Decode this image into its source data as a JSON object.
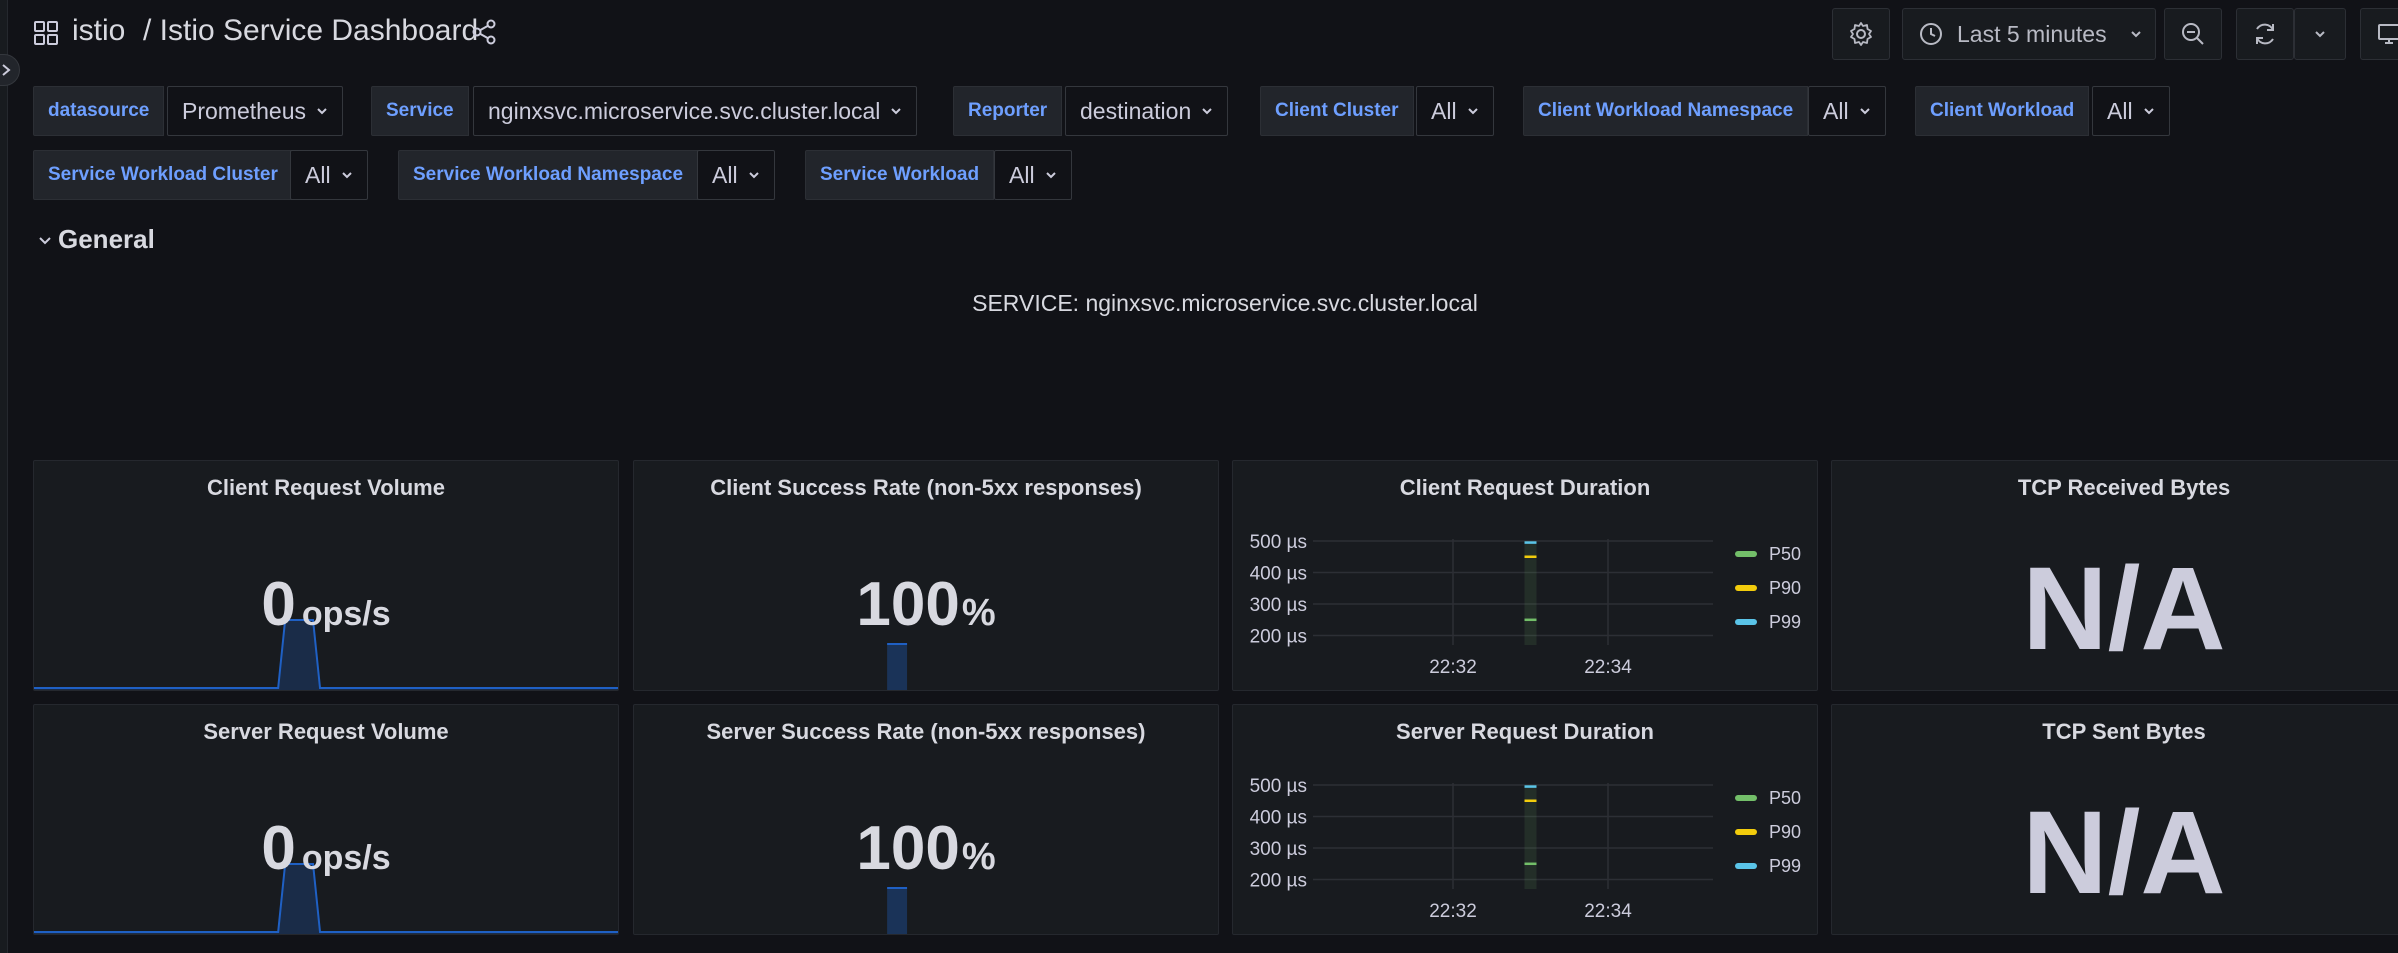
{
  "header": {
    "home": "istio",
    "title": "/ Istio Service Dashboard",
    "time_range": "Last 5 minutes"
  },
  "variables": {
    "datasource": {
      "label": "datasource",
      "value": "Prometheus"
    },
    "service": {
      "label": "Service",
      "value": "nginxsvc.microservice.svc.cluster.local"
    },
    "reporter": {
      "label": "Reporter",
      "value": "destination"
    },
    "client_cluster": {
      "label": "Client Cluster",
      "value": "All"
    },
    "client_workload_namespace": {
      "label": "Client Workload Namespace",
      "value": "All"
    },
    "client_workload": {
      "label": "Client Workload",
      "value": "All"
    },
    "service_workload_cluster": {
      "label": "Service Workload Cluster",
      "value": "All"
    },
    "service_workload_namespace": {
      "label": "Service Workload Namespace",
      "value": "All"
    },
    "service_workload": {
      "label": "Service Workload",
      "value": "All"
    }
  },
  "row": {
    "title": "General"
  },
  "service_banner": "SERVICE: nginxsvc.microservice.svc.cluster.local",
  "panels": {
    "client_request_volume": {
      "title": "Client Request Volume",
      "value": "0",
      "unit": "ops/s"
    },
    "client_success_rate": {
      "title": "Client Success Rate (non-5xx responses)",
      "value": "100",
      "unit": "%"
    },
    "client_request_duration": {
      "title": "Client Request Duration"
    },
    "tcp_received_bytes": {
      "title": "TCP Received Bytes",
      "value": "N/A"
    },
    "server_request_volume": {
      "title": "Server Request Volume",
      "value": "0",
      "unit": "ops/s"
    },
    "server_success_rate": {
      "title": "Server Success Rate (non-5xx responses)",
      "value": "100",
      "unit": "%"
    },
    "server_request_duration": {
      "title": "Server Request Duration"
    },
    "tcp_sent_bytes": {
      "title": "TCP Sent Bytes",
      "value": "N/A"
    }
  },
  "colors": {
    "p50": "#73bf69",
    "p90": "#f2cc0c",
    "p99": "#5ac4e8",
    "link": "#6e9fff",
    "spark": "#1f60c4"
  },
  "chart_data": [
    {
      "type": "line",
      "title": "Client Request Duration",
      "y_ticks": [
        "500 µs",
        "400 µs",
        "300 µs",
        "200 µs"
      ],
      "y_tick_values": [
        500,
        400,
        300,
        200
      ],
      "ylim": [
        170,
        500
      ],
      "x_ticks": [
        "22:32",
        "22:34"
      ],
      "series": [
        {
          "name": "P50",
          "color": "#73bf69",
          "points": [
            {
              "x": "22:33",
              "y": 250
            }
          ]
        },
        {
          "name": "P90",
          "color": "#f2cc0c",
          "points": [
            {
              "x": "22:33",
              "y": 450
            }
          ]
        },
        {
          "name": "P99",
          "color": "#5ac4e8",
          "points": [
            {
              "x": "22:33",
              "y": 495
            }
          ]
        }
      ],
      "legend": "right"
    },
    {
      "type": "line",
      "title": "Server Request Duration",
      "y_ticks": [
        "500 µs",
        "400 µs",
        "300 µs",
        "200 µs"
      ],
      "y_tick_values": [
        500,
        400,
        300,
        200
      ],
      "ylim": [
        170,
        500
      ],
      "x_ticks": [
        "22:32",
        "22:34"
      ],
      "series": [
        {
          "name": "P50",
          "color": "#73bf69",
          "points": [
            {
              "x": "22:33",
              "y": 250
            }
          ]
        },
        {
          "name": "P90",
          "color": "#f2cc0c",
          "points": [
            {
              "x": "22:33",
              "y": 450
            }
          ]
        },
        {
          "name": "P99",
          "color": "#5ac4e8",
          "points": [
            {
              "x": "22:33",
              "y": 495
            }
          ]
        }
      ],
      "legend": "right"
    }
  ]
}
